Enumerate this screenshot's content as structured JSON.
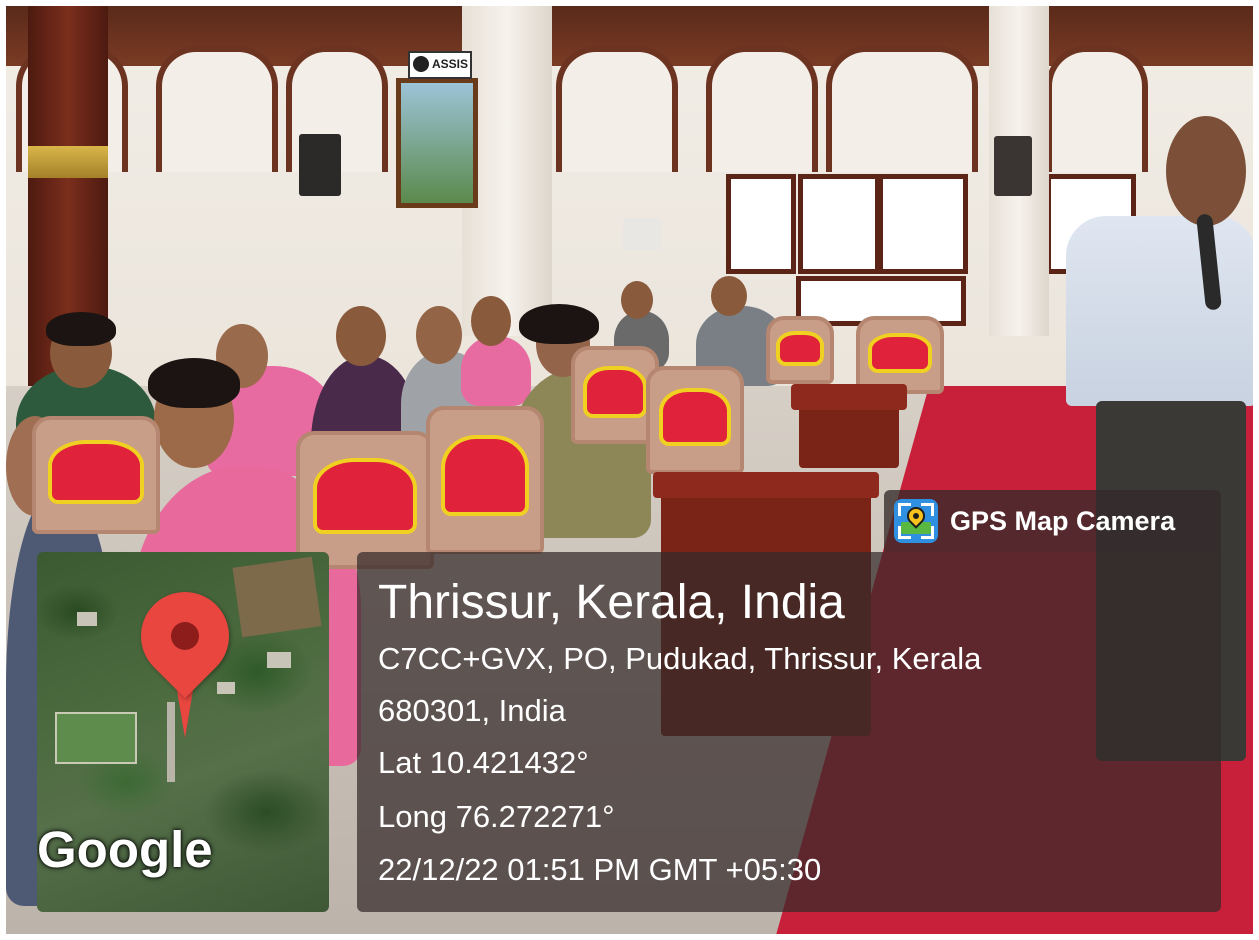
{
  "scene": {
    "description_colors": {
      "carpet": "#c8203a",
      "chair_seat": "#e0223a",
      "wood": "#5b2416",
      "overlay": "rgba(52,42,42,0.72)"
    }
  },
  "signage": {
    "wall_sign": "ASSIS"
  },
  "stamp": {
    "app_name": "GPS Map Camera",
    "app_icon": "gps-map-camera-icon",
    "map_brand": "Google",
    "map_marker_icon": "map-pin-icon",
    "place_title": "Thrissur, Kerala, India",
    "address_line_1": "C7CC+GVX, PO, Pudukad, Thrissur, Kerala",
    "address_line_2": "680301, India",
    "latitude": "Lat 10.421432°",
    "longitude": "Long 76.272271°",
    "datetime": "22/12/22 01:51 PM GMT +05:30"
  }
}
